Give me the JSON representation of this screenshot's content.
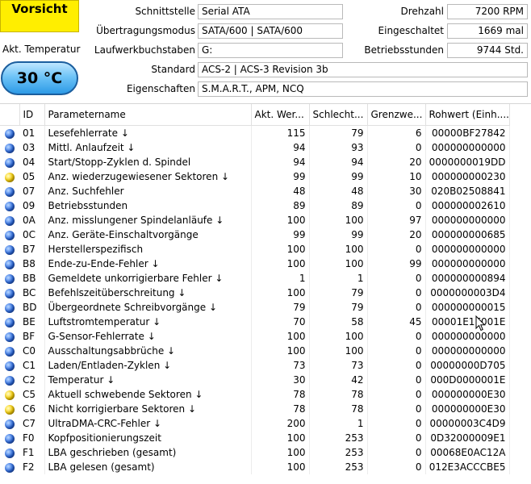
{
  "status": {
    "health": "Vorsicht",
    "temp_label": "Akt. Temperatur",
    "temperature": "30 °C"
  },
  "info": {
    "interface_label": "Schnittstelle",
    "interface": "Serial ATA",
    "transfer_label": "Übertragungsmodus",
    "transfer": "SATA/600 | SATA/600",
    "drive_letters_label": "Laufwerkbuchstaben",
    "drive_letters": "G:",
    "standard_label": "Standard",
    "standard": "ACS-2 | ACS-3 Revision 3b",
    "features_label": "Eigenschaften",
    "features": "S.M.A.R.T., APM, NCQ",
    "rpm_label": "Drehzahl",
    "rpm": "7200 RPM",
    "power_on_count_label": "Eingeschaltet",
    "power_on_count": "1669 mal",
    "power_on_hours_label": "Betriebsstunden",
    "power_on_hours": "9744 Std."
  },
  "table": {
    "headers": [
      "",
      "ID",
      "Parametername",
      "Akt. Wer...",
      "Schlecht...",
      "Grenzwe...",
      "Rohwert (Einh...."
    ],
    "rows": [
      {
        "status": "blue",
        "id": "01",
        "name": "Lesefehlerrate ↓",
        "current": "115",
        "worst": "79",
        "threshold": "6",
        "raw": "00000BF27842"
      },
      {
        "status": "blue",
        "id": "03",
        "name": "Mittl. Anlaufzeit ↓",
        "current": "94",
        "worst": "93",
        "threshold": "0",
        "raw": "000000000000"
      },
      {
        "status": "blue",
        "id": "04",
        "name": "Start/Stopp-Zyklen d. Spindel",
        "current": "94",
        "worst": "94",
        "threshold": "20",
        "raw": "0000000019DD"
      },
      {
        "status": "yellow",
        "id": "05",
        "name": "Anz. wiederzugewiesener Sektoren ↓",
        "current": "99",
        "worst": "99",
        "threshold": "10",
        "raw": "000000000230"
      },
      {
        "status": "blue",
        "id": "07",
        "name": "Anz. Suchfehler",
        "current": "48",
        "worst": "48",
        "threshold": "30",
        "raw": "020B02508841"
      },
      {
        "status": "blue",
        "id": "09",
        "name": "Betriebsstunden",
        "current": "89",
        "worst": "89",
        "threshold": "0",
        "raw": "000000002610"
      },
      {
        "status": "blue",
        "id": "0A",
        "name": "Anz. misslungener Spindelanläufe ↓",
        "current": "100",
        "worst": "100",
        "threshold": "97",
        "raw": "000000000000"
      },
      {
        "status": "blue",
        "id": "0C",
        "name": "Anz. Geräte-Einschaltvorgänge",
        "current": "99",
        "worst": "99",
        "threshold": "20",
        "raw": "000000000685"
      },
      {
        "status": "blue",
        "id": "B7",
        "name": "Herstellerspezifisch",
        "current": "100",
        "worst": "100",
        "threshold": "0",
        "raw": "000000000000"
      },
      {
        "status": "blue",
        "id": "B8",
        "name": "Ende-zu-Ende-Fehler ↓",
        "current": "100",
        "worst": "100",
        "threshold": "99",
        "raw": "000000000000"
      },
      {
        "status": "blue",
        "id": "BB",
        "name": "Gemeldete unkorrigierbare Fehler ↓",
        "current": "1",
        "worst": "1",
        "threshold": "0",
        "raw": "000000000894"
      },
      {
        "status": "blue",
        "id": "BC",
        "name": "Befehlszeitüberschreitung ↓",
        "current": "100",
        "worst": "79",
        "threshold": "0",
        "raw": "0000000003D4"
      },
      {
        "status": "blue",
        "id": "BD",
        "name": "Übergeordnete Schreibvorgänge ↓",
        "current": "79",
        "worst": "79",
        "threshold": "0",
        "raw": "000000000015"
      },
      {
        "status": "blue",
        "id": "BE",
        "name": "Luftstromtemperatur ↓",
        "current": "70",
        "worst": "58",
        "threshold": "45",
        "raw": "00001E1E001E"
      },
      {
        "status": "blue",
        "id": "BF",
        "name": "G-Sensor-Fehlerrate ↓",
        "current": "100",
        "worst": "100",
        "threshold": "0",
        "raw": "000000000000"
      },
      {
        "status": "blue",
        "id": "C0",
        "name": "Ausschaltungsabbrüche ↓",
        "current": "100",
        "worst": "100",
        "threshold": "0",
        "raw": "000000000000"
      },
      {
        "status": "blue",
        "id": "C1",
        "name": "Laden/Entladen-Zyklen ↓",
        "current": "73",
        "worst": "73",
        "threshold": "0",
        "raw": "00000000D705"
      },
      {
        "status": "blue",
        "id": "C2",
        "name": "Temperatur ↓",
        "current": "30",
        "worst": "42",
        "threshold": "0",
        "raw": "000D0000001E"
      },
      {
        "status": "yellow",
        "id": "C5",
        "name": "Aktuell schwebende Sektoren ↓",
        "current": "78",
        "worst": "78",
        "threshold": "0",
        "raw": "000000000E30"
      },
      {
        "status": "yellow",
        "id": "C6",
        "name": "Nicht korrigierbare Sektoren ↓",
        "current": "78",
        "worst": "78",
        "threshold": "0",
        "raw": "000000000E30"
      },
      {
        "status": "blue",
        "id": "C7",
        "name": "UltraDMA-CRC-Fehler ↓",
        "current": "200",
        "worst": "1",
        "threshold": "0",
        "raw": "00000003C4D9"
      },
      {
        "status": "blue",
        "id": "F0",
        "name": "Kopfpositionierungszeit",
        "current": "100",
        "worst": "253",
        "threshold": "0",
        "raw": "0D32000009E1"
      },
      {
        "status": "blue",
        "id": "F1",
        "name": "LBA geschrieben (gesamt)",
        "current": "100",
        "worst": "253",
        "threshold": "0",
        "raw": "00068E0AC12A"
      },
      {
        "status": "blue",
        "id": "F2",
        "name": "LBA gelesen (gesamt)",
        "current": "100",
        "worst": "253",
        "threshold": "0",
        "raw": "012E3ACCCBE5"
      }
    ]
  }
}
